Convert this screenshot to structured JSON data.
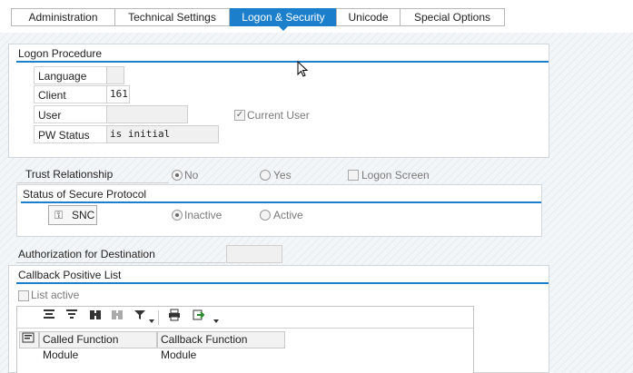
{
  "tabs": [
    {
      "label": "Administration"
    },
    {
      "label": "Technical Settings"
    },
    {
      "label": "Logon & Security"
    },
    {
      "label": "Unicode"
    },
    {
      "label": "Special Options"
    }
  ],
  "logon_procedure": {
    "title": "Logon Procedure",
    "language_label": "Language",
    "language_value": "",
    "client_label": "Client",
    "client_value": "161",
    "user_label": "User",
    "user_value": "",
    "current_user_label": "Current User",
    "current_user_checked": true,
    "pw_status_label": "PW Status",
    "pw_status_value": "is initial"
  },
  "trust": {
    "label": "Trust Relationship",
    "no_label": "No",
    "yes_label": "Yes",
    "selected": "No",
    "logon_screen_label": "Logon Screen"
  },
  "secure_protocol": {
    "title": "Status of Secure Protocol",
    "snc_button": "SNC",
    "inactive_label": "Inactive",
    "active_label": "Active",
    "selected": "Inactive"
  },
  "authorization": {
    "label": "Authorization for Destination",
    "value": ""
  },
  "callback": {
    "title": "Callback Positive List",
    "list_active_label": "List active",
    "columns": [
      "Called Function Module",
      "Callback Function Module"
    ],
    "rows": []
  },
  "icons": {
    "toolbar": [
      "align-top-icon",
      "align-bottom-icon",
      "find-icon",
      "find-next-icon",
      "filter-icon",
      "print-icon",
      "export-icon"
    ],
    "snc": "key-icon"
  },
  "colors": {
    "accent": "#1b7fcc"
  }
}
